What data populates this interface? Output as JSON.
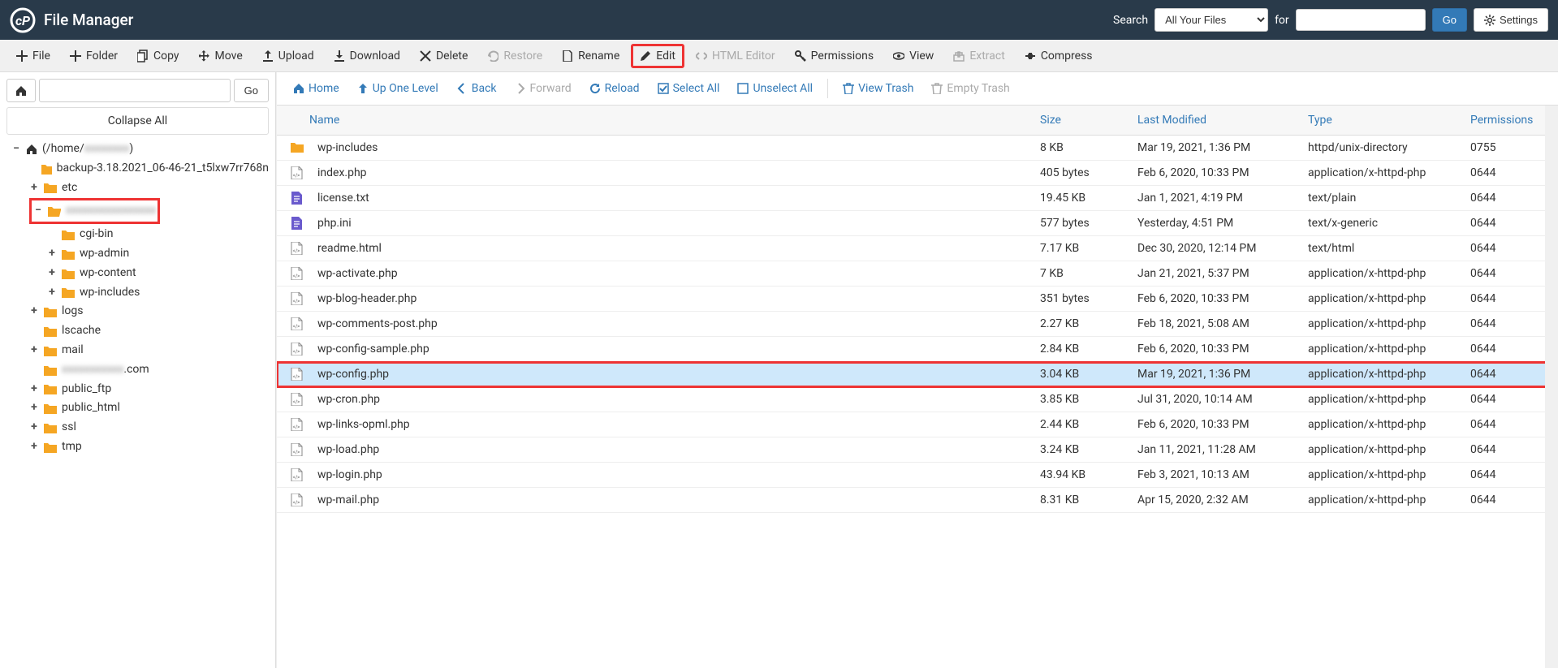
{
  "app_title": "File Manager",
  "search": {
    "label": "Search",
    "for_label": "for",
    "go_label": "Go",
    "select_value": "All Your Files"
  },
  "settings_label": "Settings",
  "toolbar": {
    "file": "File",
    "folder": "Folder",
    "copy": "Copy",
    "move": "Move",
    "upload": "Upload",
    "download": "Download",
    "delete": "Delete",
    "restore": "Restore",
    "rename": "Rename",
    "edit": "Edit",
    "html_editor": "HTML Editor",
    "permissions": "Permissions",
    "view": "View",
    "extract": "Extract",
    "compress": "Compress"
  },
  "sidebar": {
    "go_label": "Go",
    "collapse_label": "Collapse All",
    "home_path_label": "(/home/",
    "home_path_tail": ")",
    "home_path_blurred": "xxxxxxxx",
    "tree": [
      {
        "label": "backup-3.18.2021_06-46-21_t5lxw7rr768n",
        "indent": 1,
        "toggle": ""
      },
      {
        "label": "etc",
        "indent": 1,
        "toggle": "+"
      },
      {
        "label": "xxxxxxxxxxxxxxxx",
        "indent": 1,
        "toggle": "−",
        "blurred": true,
        "highlighted": true,
        "open": true
      },
      {
        "label": "cgi-bin",
        "indent": 2,
        "toggle": ""
      },
      {
        "label": "wp-admin",
        "indent": 2,
        "toggle": "+"
      },
      {
        "label": "wp-content",
        "indent": 2,
        "toggle": "+"
      },
      {
        "label": "wp-includes",
        "indent": 2,
        "toggle": "+"
      },
      {
        "label": "logs",
        "indent": 1,
        "toggle": "+"
      },
      {
        "label": "lscache",
        "indent": 1,
        "toggle": ""
      },
      {
        "label": "mail",
        "indent": 1,
        "toggle": "+"
      },
      {
        "label": "xxxxxxxxxxx.com",
        "indent": 1,
        "toggle": "",
        "blurred_partial": true
      },
      {
        "label": "public_ftp",
        "indent": 1,
        "toggle": "+"
      },
      {
        "label": "public_html",
        "indent": 1,
        "toggle": "+"
      },
      {
        "label": "ssl",
        "indent": 1,
        "toggle": "+"
      },
      {
        "label": "tmp",
        "indent": 1,
        "toggle": "+"
      }
    ]
  },
  "nav": {
    "home": "Home",
    "up": "Up One Level",
    "back": "Back",
    "forward": "Forward",
    "reload": "Reload",
    "select_all": "Select All",
    "unselect_all": "Unselect All",
    "view_trash": "View Trash",
    "empty_trash": "Empty Trash"
  },
  "columns": {
    "name": "Name",
    "size": "Size",
    "modified": "Last Modified",
    "type": "Type",
    "perm": "Permissions"
  },
  "files": [
    {
      "icon": "folder",
      "name": "wp-includes",
      "size": "8 KB",
      "modified": "Mar 19, 2021, 1:36 PM",
      "type": "httpd/unix-directory",
      "perm": "0755"
    },
    {
      "icon": "php",
      "name": "index.php",
      "size": "405 bytes",
      "modified": "Feb 6, 2020, 10:33 PM",
      "type": "application/x-httpd-php",
      "perm": "0644"
    },
    {
      "icon": "txt",
      "name": "license.txt",
      "size": "19.45 KB",
      "modified": "Jan 1, 2021, 4:19 PM",
      "type": "text/plain",
      "perm": "0644"
    },
    {
      "icon": "txt",
      "name": "php.ini",
      "size": "577 bytes",
      "modified": "Yesterday, 4:51 PM",
      "type": "text/x-generic",
      "perm": "0644"
    },
    {
      "icon": "php",
      "name": "readme.html",
      "size": "7.17 KB",
      "modified": "Dec 30, 2020, 12:14 PM",
      "type": "text/html",
      "perm": "0644"
    },
    {
      "icon": "php",
      "name": "wp-activate.php",
      "size": "7 KB",
      "modified": "Jan 21, 2021, 5:37 PM",
      "type": "application/x-httpd-php",
      "perm": "0644"
    },
    {
      "icon": "php",
      "name": "wp-blog-header.php",
      "size": "351 bytes",
      "modified": "Feb 6, 2020, 10:33 PM",
      "type": "application/x-httpd-php",
      "perm": "0644"
    },
    {
      "icon": "php",
      "name": "wp-comments-post.php",
      "size": "2.27 KB",
      "modified": "Feb 18, 2021, 5:08 AM",
      "type": "application/x-httpd-php",
      "perm": "0644"
    },
    {
      "icon": "php",
      "name": "wp-config-sample.php",
      "size": "2.84 KB",
      "modified": "Feb 6, 2020, 10:33 PM",
      "type": "application/x-httpd-php",
      "perm": "0644"
    },
    {
      "icon": "php",
      "name": "wp-config.php",
      "size": "3.04 KB",
      "modified": "Mar 19, 2021, 1:36 PM",
      "type": "application/x-httpd-php",
      "perm": "0644",
      "selected": true,
      "highlighted": true
    },
    {
      "icon": "php",
      "name": "wp-cron.php",
      "size": "3.85 KB",
      "modified": "Jul 31, 2020, 10:14 AM",
      "type": "application/x-httpd-php",
      "perm": "0644"
    },
    {
      "icon": "php",
      "name": "wp-links-opml.php",
      "size": "2.44 KB",
      "modified": "Feb 6, 2020, 10:33 PM",
      "type": "application/x-httpd-php",
      "perm": "0644"
    },
    {
      "icon": "php",
      "name": "wp-load.php",
      "size": "3.24 KB",
      "modified": "Jan 11, 2021, 11:28 AM",
      "type": "application/x-httpd-php",
      "perm": "0644"
    },
    {
      "icon": "php",
      "name": "wp-login.php",
      "size": "43.94 KB",
      "modified": "Feb 3, 2021, 10:13 AM",
      "type": "application/x-httpd-php",
      "perm": "0644"
    },
    {
      "icon": "php",
      "name": "wp-mail.php",
      "size": "8.31 KB",
      "modified": "Apr 15, 2020, 2:32 AM",
      "type": "application/x-httpd-php",
      "perm": "0644"
    }
  ]
}
